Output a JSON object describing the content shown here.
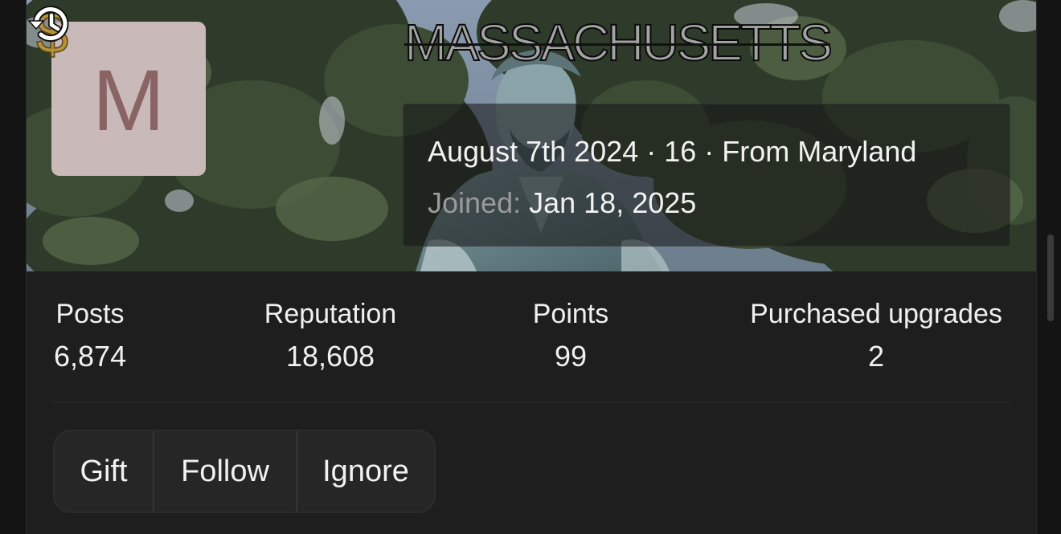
{
  "profile": {
    "avatar_letter": "M",
    "avatar_bg": "#c9b9b9",
    "avatar_fg": "#8a6464",
    "username": "MASSACHUSETTS",
    "badges": [
      "dollar-icon",
      "history-icon"
    ],
    "info_line": "August 7th 2024 · 16 · From Maryland",
    "joined_label": "Joined:",
    "joined_value": "Jan 18, 2025"
  },
  "stats": [
    {
      "label": "Posts",
      "value": "6,874"
    },
    {
      "label": "Reputation",
      "value": "18,608"
    },
    {
      "label": "Points",
      "value": "99"
    },
    {
      "label": "Purchased upgrades",
      "value": "2"
    }
  ],
  "actions": {
    "gift": "Gift",
    "follow": "Follow",
    "ignore": "Ignore"
  },
  "colors": {
    "background": "#141414",
    "card": "#1e1e1e",
    "button_bg": "#262626",
    "gold": "#b8923a"
  }
}
